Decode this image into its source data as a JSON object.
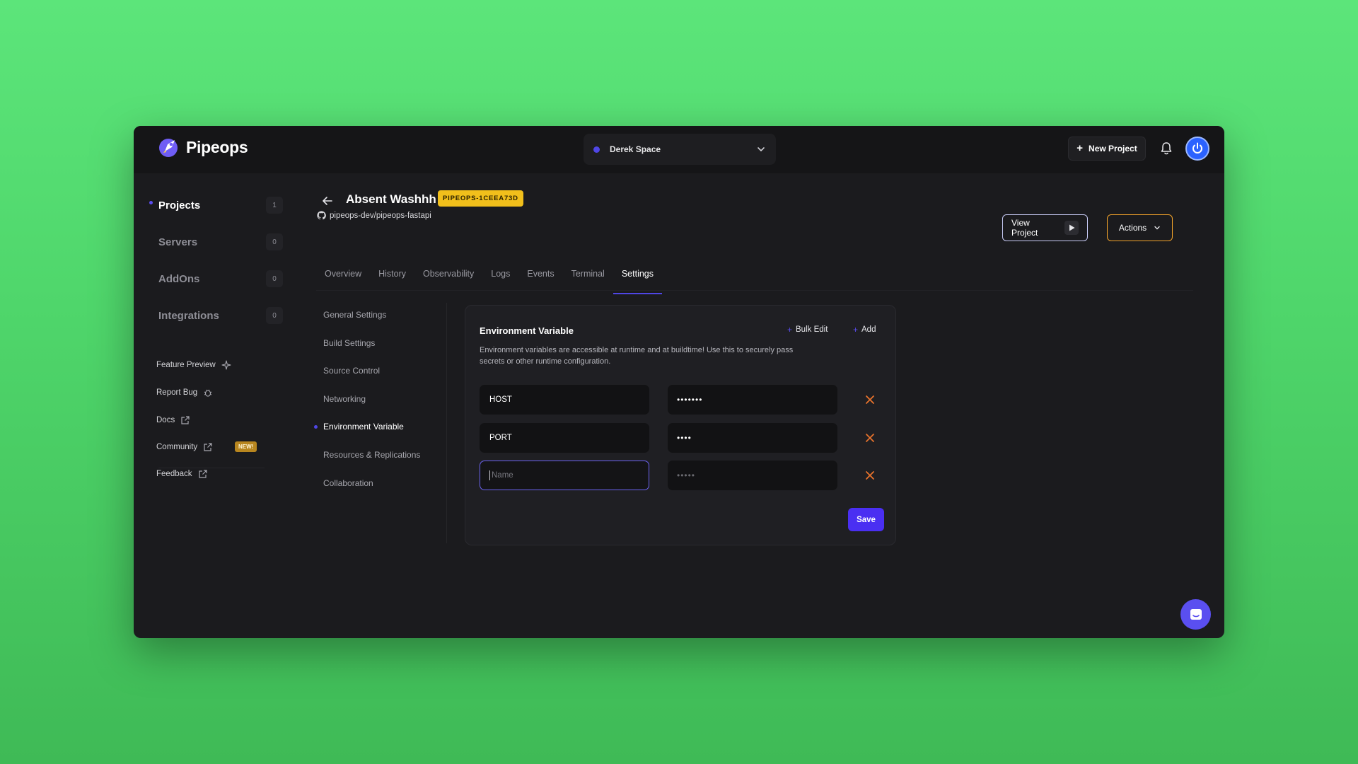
{
  "app": {
    "name": "Pipeops"
  },
  "topbar": {
    "workspace": "Derek Space",
    "new_project": "New Project"
  },
  "sidebar": {
    "items": [
      {
        "label": "Projects",
        "count": "1",
        "active": true
      },
      {
        "label": "Servers",
        "count": "0"
      },
      {
        "label": "AddOns",
        "count": "0"
      },
      {
        "label": "Integrations",
        "count": "0"
      }
    ],
    "links": [
      {
        "label": "Feature Preview",
        "icon": "sparkle-icon"
      },
      {
        "label": "Report Bug",
        "icon": "bug-icon"
      },
      {
        "label": "Docs",
        "icon": "external-link-icon"
      },
      {
        "label": "Community",
        "icon": "external-link-icon",
        "badge": "NEW!"
      },
      {
        "label": "Feedback",
        "icon": "external-link-icon"
      }
    ]
  },
  "project": {
    "title": "Absent Washhh",
    "id": "PIPEOPS-1CEEA73D",
    "repo": "pipeops-dev/pipeops-fastapi",
    "view_project": "View Project",
    "actions": "Actions"
  },
  "tabs": [
    "Overview",
    "History",
    "Observability",
    "Logs",
    "Events",
    "Terminal",
    "Settings"
  ],
  "active_tab": "Settings",
  "settings_menu": [
    "General Settings",
    "Build Settings",
    "Source Control",
    "Networking",
    "Environment Variable",
    "Resources & Replications",
    "Collaboration"
  ],
  "env": {
    "title": "Environment Variable",
    "bulk_edit": "Bulk Edit",
    "add": "Add",
    "description": "Environment variables are accessible at runtime and at buildtime! Use this to securely pass secrets or other runtime configuration.",
    "rows": [
      {
        "name": "HOST",
        "value": "•••••••"
      },
      {
        "name": "PORT",
        "value": "••••"
      }
    ],
    "new_row": {
      "name_placeholder": "Name",
      "value_placeholder": "•••••"
    },
    "save": "Save"
  },
  "colors": {
    "accent": "#4f46e5",
    "badge": "#f1bf1b",
    "remove": "#e8722c",
    "background": "#1b1b1e"
  }
}
